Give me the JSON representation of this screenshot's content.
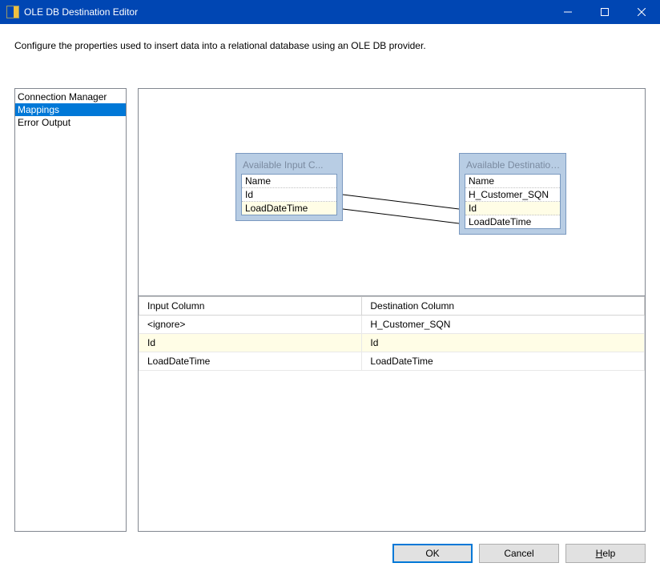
{
  "title": "OLE DB Destination Editor",
  "instruction": "Configure the properties used to insert data into a relational database using an OLE DB provider.",
  "nav": {
    "items": [
      "Connection Manager",
      "Mappings",
      "Error Output"
    ],
    "selected": 1
  },
  "input_box": {
    "title": "Available Input C...",
    "items": [
      "Name",
      "Id",
      "LoadDateTime"
    ],
    "highlight": 2
  },
  "dest_box": {
    "title": "Available Destination...",
    "items": [
      "Name",
      "H_Customer_SQN",
      "Id",
      "LoadDateTime"
    ],
    "highlight": 2
  },
  "map_table": {
    "headers": [
      "Input Column",
      "Destination Column"
    ],
    "rows": [
      {
        "in": "<ignore>",
        "out": "H_Customer_SQN",
        "hl": false
      },
      {
        "in": "Id",
        "out": "Id",
        "hl": true
      },
      {
        "in": "LoadDateTime",
        "out": "LoadDateTime",
        "hl": false
      }
    ]
  },
  "buttons": {
    "ok": "OK",
    "cancel": "Cancel",
    "help_prefix": "H",
    "help_rest": "elp"
  }
}
